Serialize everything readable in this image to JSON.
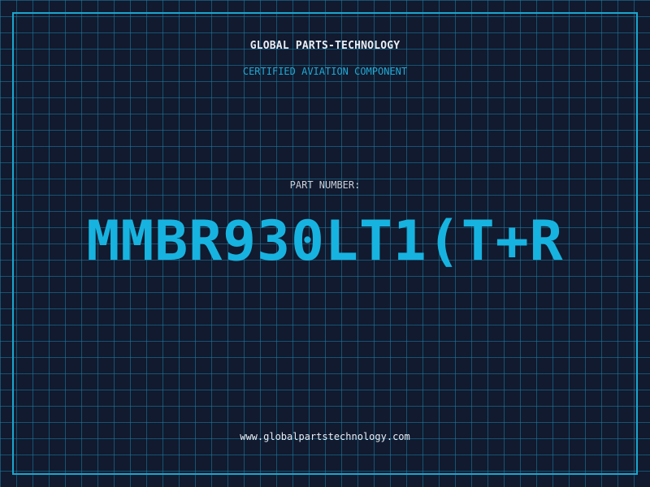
{
  "header": {
    "company": "GLOBAL PARTS-TECHNOLOGY",
    "subtitle": "CERTIFIED AVIATION COMPONENT"
  },
  "main": {
    "label": "PART NUMBER:",
    "part_number": "MMBR930LT1(T+R"
  },
  "footer": {
    "website": "www.globalpartstechnology.com"
  },
  "colors": {
    "background": "#111a2e",
    "grid": "#1c80a8",
    "accent": "#17b3e0",
    "text": "#e8edf5"
  }
}
